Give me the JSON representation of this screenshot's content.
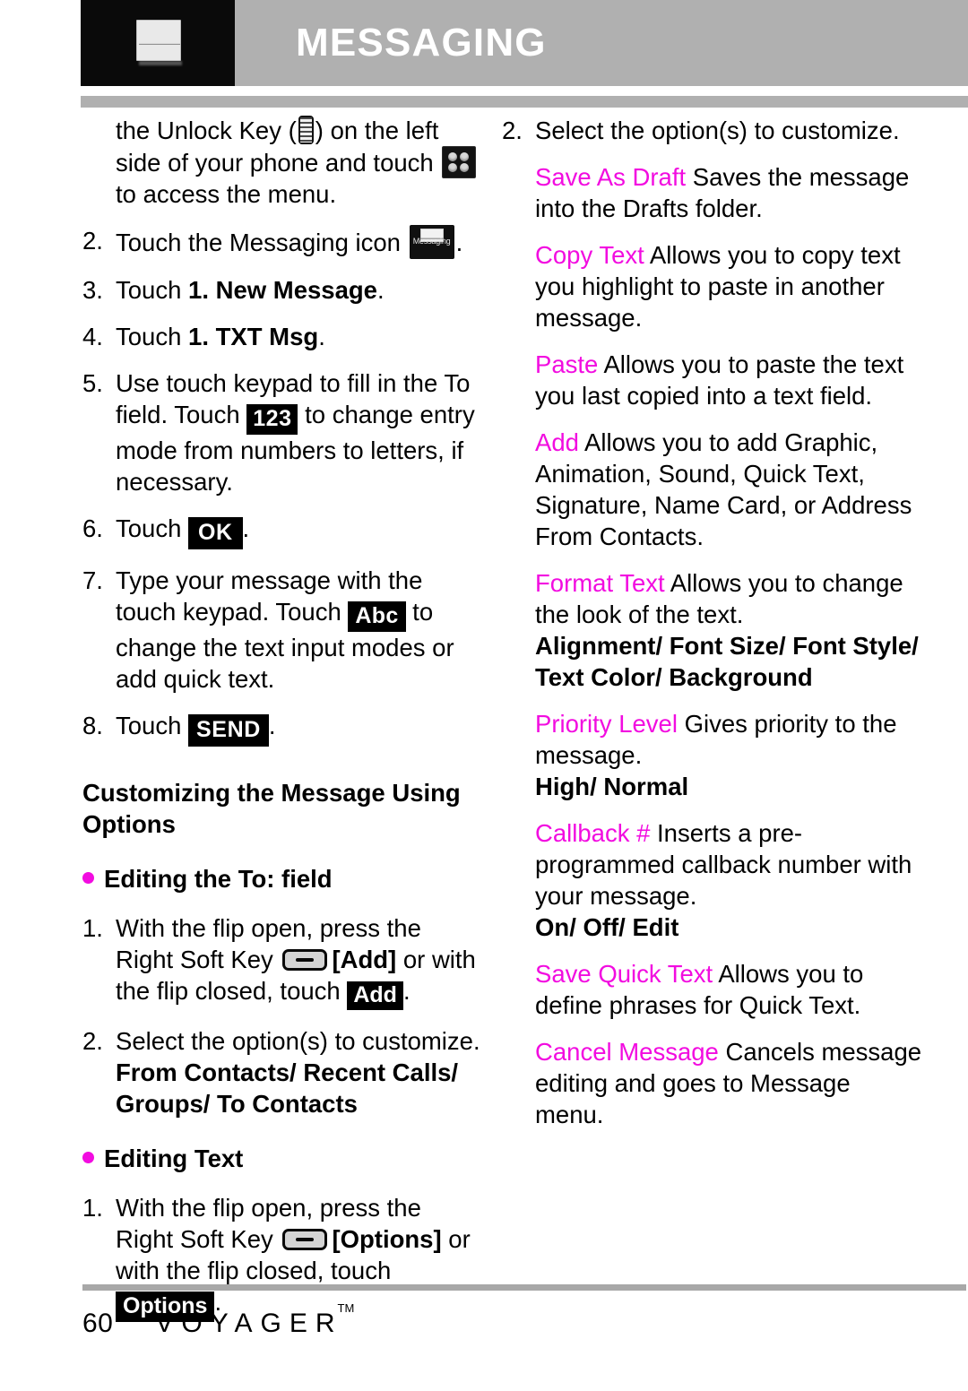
{
  "header": {
    "title": "MESSAGING",
    "icon": "envelope-icon"
  },
  "left_column": {
    "steps": [
      {
        "num": "",
        "text_before": "the Unlock Key (",
        "icon1": "unlock-key-icon",
        "text_mid": ") on the left side of your phone and touch ",
        "icon2": "menu-grid-icon",
        "text_after": " to access the menu."
      },
      {
        "num": "2.",
        "text_before": "Touch the Messaging icon ",
        "icon1": "messaging-app-icon",
        "icon_label": "Messaging",
        "text_after": "."
      },
      {
        "num": "3.",
        "text_before": "Touch ",
        "bold": "1. New Message",
        "text_after": "."
      },
      {
        "num": "4.",
        "text_before": "Touch ",
        "bold": "1. TXT Msg",
        "text_after": "."
      },
      {
        "num": "5.",
        "text_before": "Use touch keypad to fill in the To field. Touch ",
        "badge": "123",
        "text_after": " to change entry mode from numbers to letters, if necessary."
      },
      {
        "num": "6.",
        "text_before": "Touch ",
        "badge": "OK",
        "text_after": "."
      },
      {
        "num": "7.",
        "text_before": "Type your message with the touch keypad. Touch ",
        "badge": "Abc",
        "text_after": " to change the text input modes or add quick text."
      },
      {
        "num": "8.",
        "text_before": "Touch ",
        "badge": "SEND",
        "text_after": "."
      }
    ],
    "section_heading": "Customizing the Message Using Options",
    "subsection_1": {
      "bullet_title": "Editing the To: field",
      "step1": {
        "num": "1.",
        "text_before": "With the flip open, press the Right Soft Key ",
        "icon": "soft-key-icon",
        "bracket": "[Add]",
        "text_mid": " or with the flip closed, touch ",
        "badge": "Add",
        "text_after": "."
      },
      "step2": {
        "num": "2.",
        "text": "Select the option(s) to customize.",
        "suboptions": "From Contacts/ Recent Calls/ Groups/ To Contacts"
      }
    },
    "subsection_2": {
      "bullet_title": "Editing Text",
      "step1": {
        "num": "1.",
        "text_before": "With the flip open, press the Right Soft Key ",
        "icon": "soft-key-icon",
        "bracket": "[Options]",
        "text_mid": " or with the flip closed, touch ",
        "badge": "Options",
        "text_after": "."
      }
    }
  },
  "right_column": {
    "step": {
      "num": "2.",
      "text": "Select the option(s) to customize."
    },
    "options": [
      {
        "term": "Save As Draft",
        "desc": " Saves the message into the Drafts folder."
      },
      {
        "term": "Copy Text",
        "desc": " Allows you to copy text you highlight to paste in another message."
      },
      {
        "term": "Paste",
        "desc": " Allows you to paste the text you last copied into a text field."
      },
      {
        "term": "Add",
        "desc": " Allows you to add Graphic, Animation, Sound, Quick Text, Signature, Name Card, or Address From Contacts."
      },
      {
        "term": "Format Text",
        "desc": " Allows you to change the look of the text.",
        "suboptions": "Alignment/ Font Size/ Font Style/ Text Color/ Background"
      },
      {
        "term": "Priority Level",
        "desc": " Gives priority to the message.",
        "suboptions": "High/ Normal"
      },
      {
        "term": "Callback #",
        "desc": " Inserts a pre-programmed callback number with your message.",
        "suboptions": "On/ Off/ Edit"
      },
      {
        "term": "Save Quick Text",
        "desc": " Allows you to define phrases for Quick Text."
      },
      {
        "term": "Cancel Message",
        "desc": " Cancels message editing and goes to Message menu."
      }
    ]
  },
  "footer": {
    "page_number": "60",
    "brand": "VOYAGER",
    "trademark": "TM"
  },
  "colors": {
    "accent_magenta": "#f20ce0",
    "header_gray": "#b0b0b0",
    "icon_box_black": "#0a0a0a"
  }
}
